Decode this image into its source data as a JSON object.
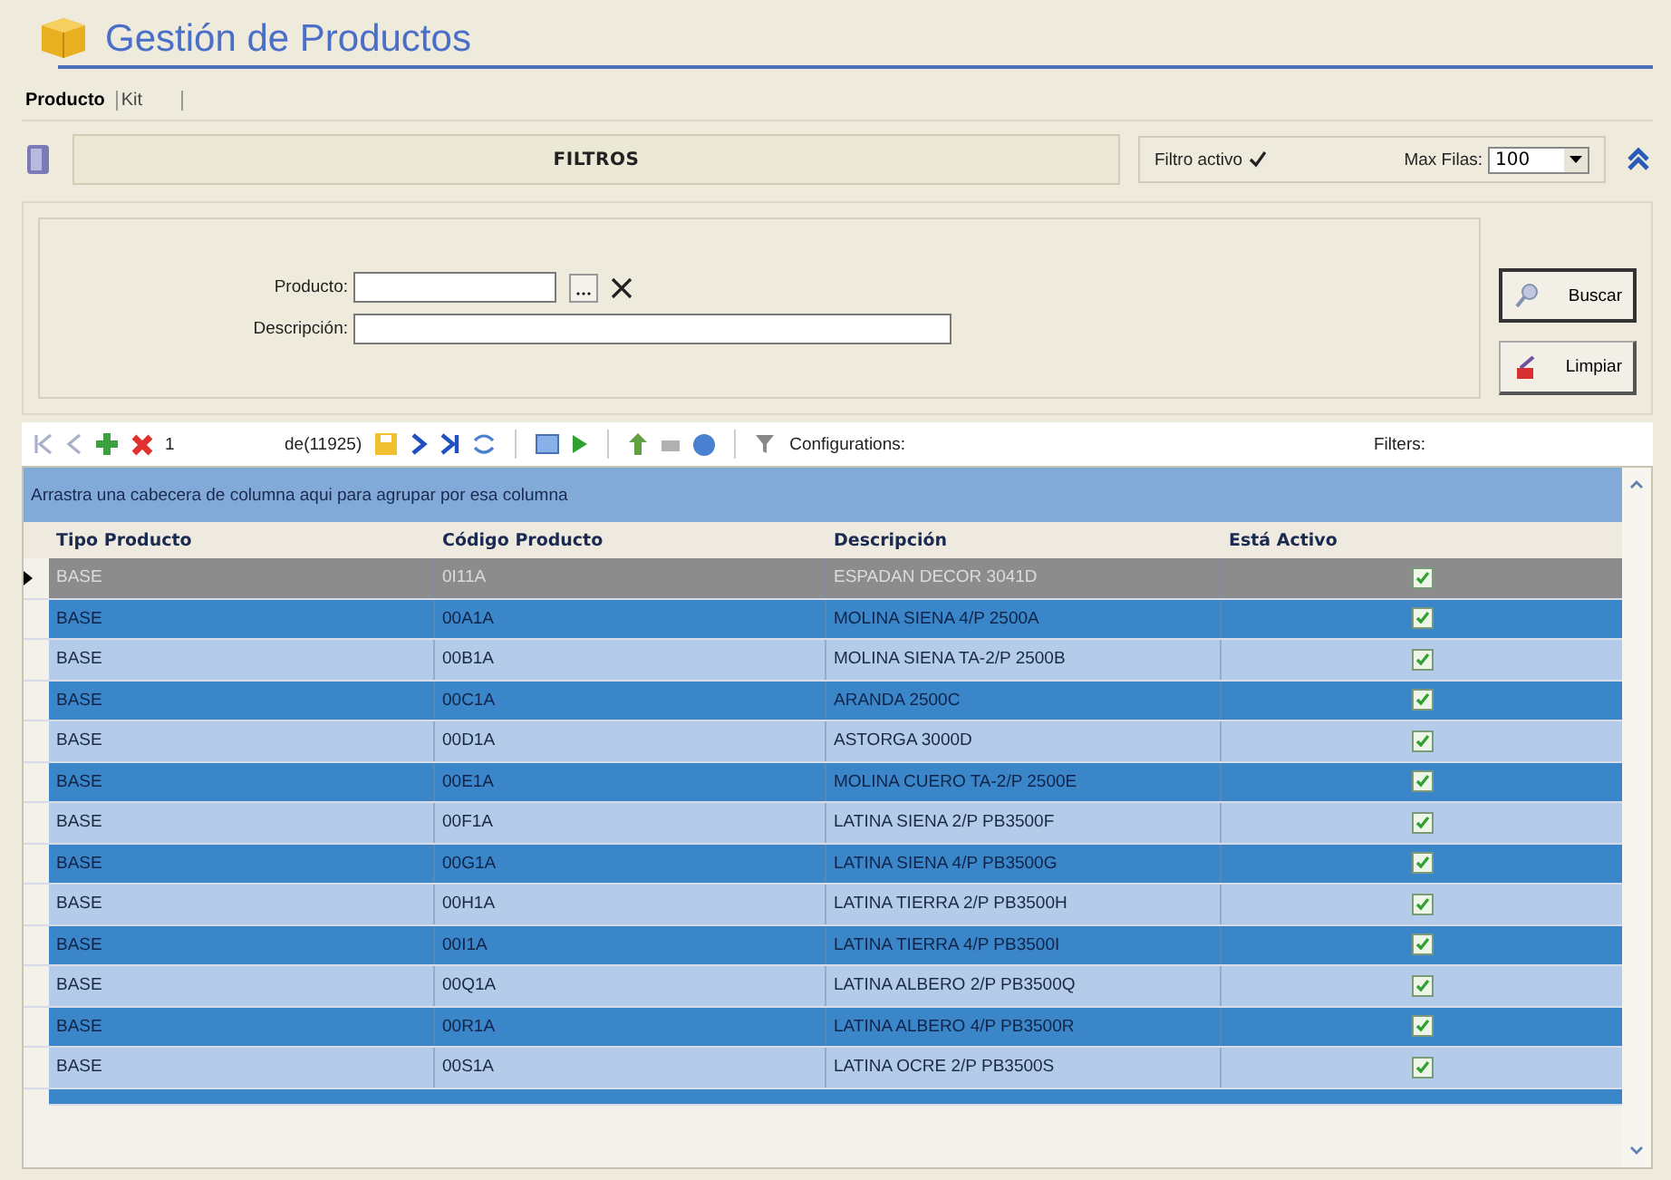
{
  "title": "Gestión de Productos",
  "tabs": [
    {
      "label": "Producto",
      "selected": true
    },
    {
      "label": "Kit",
      "selected": false
    }
  ],
  "filter_bar": {
    "label": "FILTROS",
    "active_label": "Filtro activo",
    "active": true,
    "max_rows_label": "Max Filas:",
    "max_rows": "100"
  },
  "fields": [
    {
      "label": "Producto:",
      "kind": "lookup"
    },
    {
      "label": "Descripción:",
      "kind": "text"
    }
  ],
  "buttons": [
    {
      "label": "Buscar",
      "kind": "search"
    },
    {
      "label": "Limpiar",
      "kind": "clear"
    }
  ],
  "navigator": {
    "record": "1",
    "count": "de(11925)",
    "configurations": "Configurations:",
    "filters": "Filters:"
  },
  "group_hint": "Arrastra una cabecera de columna aqui para agrupar por esa columna",
  "columns": [
    "Tipo Producto",
    "Código Producto",
    "Descripción",
    "Está Activo"
  ],
  "rows": [
    {
      "type": "BASE",
      "code": "0I11A",
      "description": "ESPADAN DECOR 3041D",
      "active": true,
      "selected": true
    },
    {
      "type": "BASE",
      "code": "00A1A",
      "description": "MOLINA SIENA 4/P 2500A",
      "active": true,
      "selected": false
    },
    {
      "type": "BASE",
      "code": "00B1A",
      "description": "MOLINA SIENA TA-2/P 2500B",
      "active": true,
      "selected": false
    },
    {
      "type": "BASE",
      "code": "00C1A",
      "description": "ARANDA 2500C",
      "active": true,
      "selected": false
    },
    {
      "type": "BASE",
      "code": "00D1A",
      "description": "ASTORGA 3000D",
      "active": true,
      "selected": false
    },
    {
      "type": "BASE",
      "code": "00E1A",
      "description": "MOLINA CUERO TA-2/P 2500E",
      "active": true,
      "selected": false
    },
    {
      "type": "BASE",
      "code": "00F1A",
      "description": "LATINA SIENA 2/P PB3500F",
      "active": true,
      "selected": false
    },
    {
      "type": "BASE",
      "code": "00G1A",
      "description": "LATINA SIENA 4/P PB3500G",
      "active": true,
      "selected": false
    },
    {
      "type": "BASE",
      "code": "00H1A",
      "description": "LATINA TIERRA 2/P PB3500H",
      "active": true,
      "selected": false
    },
    {
      "type": "BASE",
      "code": "00I1A",
      "description": "LATINA TIERRA 4/P PB3500I",
      "active": true,
      "selected": false
    },
    {
      "type": "BASE",
      "code": "00Q1A",
      "description": "LATINA ALBERO 2/P PB3500Q",
      "active": true,
      "selected": false
    },
    {
      "type": "BASE",
      "code": "00R1A",
      "description": "LATINA ALBERO 4/P PB3500R",
      "active": true,
      "selected": false
    },
    {
      "type": "BASE",
      "code": "00S1A",
      "description": "LATINA OCRE 2/P PB3500S",
      "active": true,
      "selected": false
    }
  ]
}
